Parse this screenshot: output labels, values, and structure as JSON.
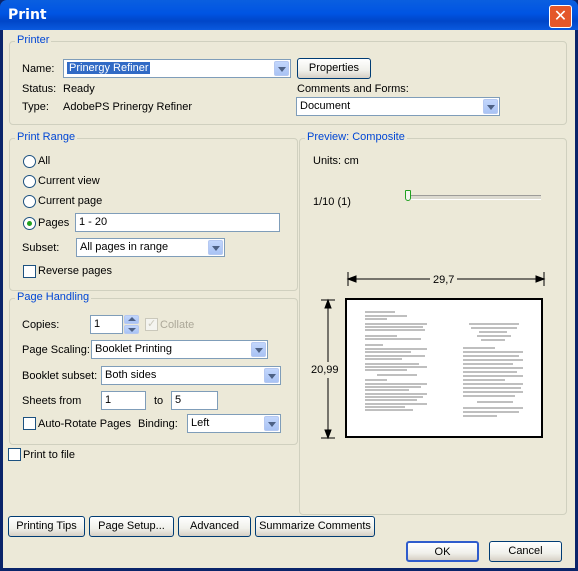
{
  "window": {
    "title": "Print",
    "close_glyph": "✕"
  },
  "printer": {
    "legend": "Printer",
    "name_label": "Name:",
    "name_value": "Prinergy Refiner",
    "properties_label": "Properties",
    "status_label": "Status:",
    "status_value": "Ready",
    "type_label": "Type:",
    "type_value": "AdobePS Prinergy Refiner",
    "comments_label": "Comments and Forms:",
    "comments_value": "Document"
  },
  "print_range": {
    "legend": "Print Range",
    "options": [
      "All",
      "Current view",
      "Current page",
      "Pages"
    ],
    "selected": "Pages",
    "pages_value": "1 - 20",
    "subset_label": "Subset:",
    "subset_value": "All pages in range",
    "reverse_label": "Reverse pages",
    "reverse_checked": false
  },
  "page_handling": {
    "legend": "Page Handling",
    "copies_label": "Copies:",
    "copies_value": "1",
    "collate_label": "Collate",
    "collate_checked": true,
    "scaling_label": "Page Scaling:",
    "scaling_value": "Booklet Printing",
    "booklet_subset_label": "Booklet subset:",
    "booklet_subset_value": "Both sides",
    "sheets_from_label": "Sheets from",
    "sheets_from_value": "1",
    "sheets_to_label": "to",
    "sheets_to_value": "5",
    "auto_rotate_label": "Auto-Rotate Pages",
    "auto_rotate_checked": false,
    "binding_label": "Binding:",
    "binding_value": "Left"
  },
  "print_to_file": {
    "label": "Print to file",
    "checked": false
  },
  "preview": {
    "legend": "Preview: Composite",
    "units": "Units: cm",
    "page_indicator": "1/10 (1)",
    "width_label": "29,7",
    "height_label": "20,99",
    "slider_position": 0
  },
  "buttons": {
    "printing_tips": "Printing Tips",
    "page_setup": "Page Setup...",
    "advanced": "Advanced",
    "summarize": "Summarize Comments",
    "ok": "OK",
    "cancel": "Cancel"
  }
}
